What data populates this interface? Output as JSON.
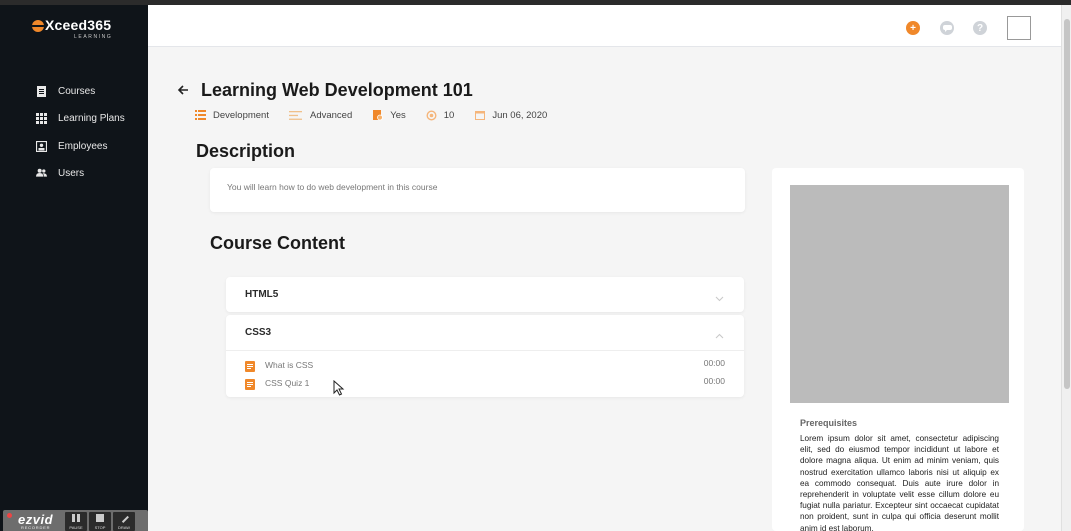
{
  "sidebar": {
    "logo": {
      "text": "Xceed365",
      "subtitle": "LEARNING"
    },
    "items": [
      {
        "label": "Courses",
        "icon": "document-icon"
      },
      {
        "label": "Learning Plans",
        "icon": "grid-icon"
      },
      {
        "label": "Employees",
        "icon": "id-card-icon"
      },
      {
        "label": "Users",
        "icon": "users-icon"
      }
    ]
  },
  "recorder": {
    "brand": "ezvid",
    "subtitle": "RECORDER",
    "buttons": [
      "PAUSE",
      "STOP",
      "DRAW"
    ]
  },
  "header": {
    "icons": [
      "add-icon",
      "chat-icon",
      "help-icon"
    ],
    "colors": {
      "add": "#f0882a",
      "muted": "#cfd3d8"
    }
  },
  "course": {
    "title": "Learning Web Development 101",
    "meta": {
      "category": "Development",
      "level": "Advanced",
      "certificate": "Yes",
      "count": "10",
      "date": "Jun 06, 2020"
    }
  },
  "description": {
    "heading": "Description",
    "text": "You will learn how to do web development in this course"
  },
  "content": {
    "heading": "Course Content",
    "sections": [
      {
        "title": "HTML5",
        "expanded": false,
        "lessons": []
      },
      {
        "title": "CSS3",
        "expanded": true,
        "lessons": [
          {
            "name": "What is CSS",
            "duration": "00:00"
          },
          {
            "name": "CSS Quiz 1",
            "duration": "00:00"
          }
        ]
      }
    ]
  },
  "prerequisites": {
    "heading": "Prerequisites",
    "text": "Lorem ipsum dolor sit amet, consectetur adipiscing elit, sed do eiusmod tempor incididunt ut labore et dolore magna aliqua. Ut enim ad minim veniam, quis nostrud exercitation ullamco laboris nisi ut aliquip ex ea commodo consequat. Duis aute irure dolor in reprehenderit in voluptate velit esse cillum dolore eu fugiat nulla pariatur. Excepteur sint occaecat cupidatat non proident, sunt in culpa qui officia deserunt mollit anim id est laborum."
  },
  "accent_color": "#f0882a"
}
